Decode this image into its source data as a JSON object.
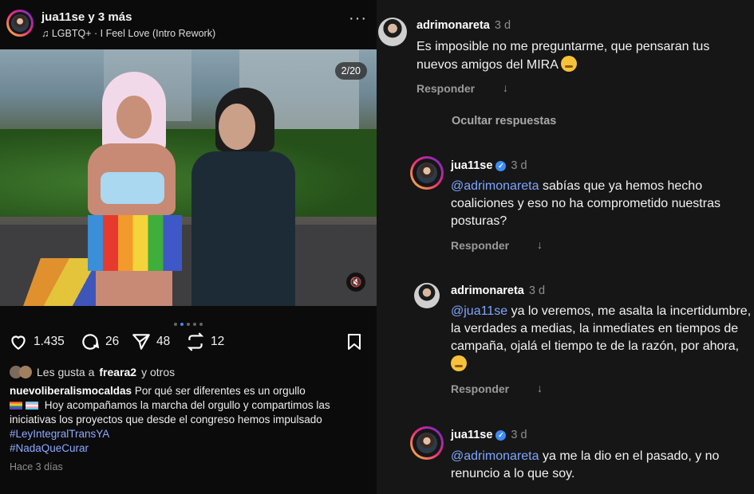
{
  "post": {
    "header": {
      "username": "jua11se",
      "coauthors": "y 3 más",
      "music_icon": "music-note-icon",
      "music": "LGBTQ+ · I Feel Love (Intro Rework)",
      "more_icon": "more-dots-icon"
    },
    "media": {
      "counter": "2/20",
      "mute_icon": "muted-speaker-icon",
      "carousel_dots": 5,
      "active_dot": 2
    },
    "actions": {
      "likes": "1.435",
      "comments": "26",
      "shares": "48",
      "reposts": "12"
    },
    "liked_by": {
      "prefix": "Les gusta a",
      "user": "freara2",
      "suffix": "y otros"
    },
    "caption": {
      "username": "nuevoliberalismocaldas",
      "text1": "Por qué ser diferentes es un orgullo",
      "text2": "Hoy acompañamos la marcha del orgullo y compartimos las iniciativas los proyectos que desde el congreso hemos impulsado",
      "hashtag1": "#LeyIntegralTransYA",
      "hashtag2": "#NadaQueCurar"
    },
    "time_ago": "Hace 3 días"
  },
  "comments": [
    {
      "username": "adrimonareta",
      "time": "3 d",
      "text": "Es imposible no me preguntarme, que pensaran tus nuevos amigos del MIRA",
      "emoji": "sweat-smile-emoji",
      "reply_label": "Responder"
    },
    {
      "username": "jua11se",
      "time": "3 d",
      "verified": true,
      "mention": "@adrimonareta",
      "text": "sabías que ya hemos hecho coaliciones y eso no ha comprometido nuestras posturas?",
      "reply_label": "Responder"
    },
    {
      "username": "adrimonareta",
      "time": "3 d",
      "mention": "@jua11se",
      "text": "ya lo veremos, me asalta la incertidumbre,  la verdades a medias, la inmediates en tiempos de campaña, ojalá el tiempo te de la razón,  por ahora,",
      "emoji": "grimace-emoji",
      "reply_label": "Responder"
    },
    {
      "username": "jua11se",
      "time": "3 d",
      "verified": true,
      "mention": "@adrimonareta",
      "text": "ya me la dio en el pasado, y no renuncio a lo que soy."
    }
  ],
  "hide_replies": "Ocultar respuestas",
  "colors": {
    "mention": "#7ea6ff",
    "verified": "#3b8cf5",
    "background_left": "#0b0b0b",
    "background_right": "#161616"
  }
}
